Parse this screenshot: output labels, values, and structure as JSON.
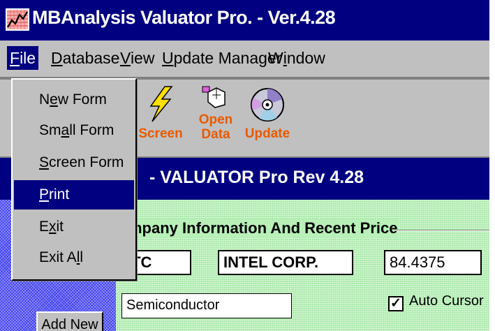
{
  "window": {
    "title": "MBAnalysis Valuator Pro. - Ver.4.28"
  },
  "menubar": {
    "items": [
      {
        "label": "File",
        "mnemonic": "F",
        "rest": "ile"
      },
      {
        "label": "Database",
        "mnemonic": "D",
        "rest": "atabase"
      },
      {
        "label": "View",
        "mnemonic": "V",
        "rest": "iew"
      },
      {
        "label": "Update Manager",
        "mnemonic": "U",
        "rest": "pdate Manager"
      },
      {
        "label": "Window",
        "pre": "W",
        "mnemonic": "i",
        "rest": "ndow"
      }
    ]
  },
  "file_menu": {
    "items": [
      {
        "label": "New Form",
        "pre": "N",
        "mnemonic": "e",
        "rest": "w Form"
      },
      {
        "label": "Small Form",
        "pre": "Sm",
        "mnemonic": "a",
        "rest": "ll Form"
      },
      {
        "label": "Screen Form",
        "pre": "",
        "mnemonic": "S",
        "rest": "creen Form"
      },
      {
        "label": "Print",
        "pre": "",
        "mnemonic": "P",
        "rest": "rint"
      },
      {
        "label": "Exit",
        "pre": "E",
        "mnemonic": "x",
        "rest": "it"
      },
      {
        "label": "Exit All",
        "pre": "Exit A",
        "mnemonic": "l",
        "rest": "l"
      }
    ],
    "highlighted": "Print"
  },
  "toolbar": {
    "screen_label": "Screen",
    "open_label_1": "Open",
    "open_label_2": "Data",
    "update_label": "Update"
  },
  "form": {
    "header": "- VALUATOR Pro Rev 4.28",
    "group_title": "mpany Information And Recent Price",
    "ticker": "TC",
    "company_name": "INTEL CORP.",
    "price": "84.4375",
    "industry": "Semiconductor",
    "auto_cursor_label": "Auto Cursor",
    "auto_cursor_checked": true,
    "check_mark": "✓",
    "add_new_label": "Add New"
  },
  "colors": {
    "title_bar": "#000080",
    "toolbar_label": "#e85a00",
    "form_background": "#b8f0b8",
    "left_strip": "#3a3aee"
  }
}
